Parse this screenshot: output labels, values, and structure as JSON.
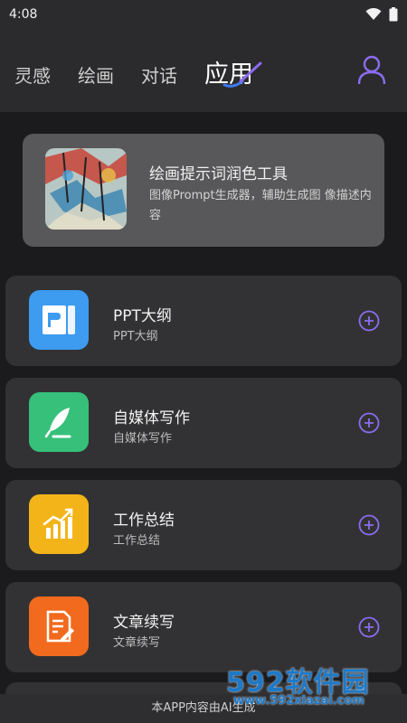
{
  "status": {
    "time": "4:08"
  },
  "header": {
    "tabs": [
      {
        "label": "灵感",
        "active": false
      },
      {
        "label": "绘画",
        "active": false
      },
      {
        "label": "对话",
        "active": false
      },
      {
        "label": "应用",
        "active": true
      }
    ]
  },
  "feature": {
    "title": "绘画提示词润色工具",
    "description": "图像Prompt生成器，辅助生成图 像描述内容"
  },
  "apps": [
    {
      "title": "PPT大纲",
      "subtitle": "PPT大纲",
      "icon": "ppt-icon",
      "color": "#3d9bf0"
    },
    {
      "title": "自媒体写作",
      "subtitle": "自媒体写作",
      "icon": "feather-icon",
      "color": "#36c07a"
    },
    {
      "title": "工作总结",
      "subtitle": "工作总结",
      "icon": "chart-icon",
      "color": "#f2b418"
    },
    {
      "title": "文章续写",
      "subtitle": "文章续写",
      "icon": "document-edit-icon",
      "color": "#f26a1e"
    }
  ],
  "footer": {
    "text": "本APP内容由AI生成"
  },
  "watermark": {
    "brand": "592软件园",
    "url": "www.592xiazai.com"
  },
  "colors": {
    "accent": "#8b6cf0",
    "background": "#1b1b1d",
    "card": "#323234"
  }
}
